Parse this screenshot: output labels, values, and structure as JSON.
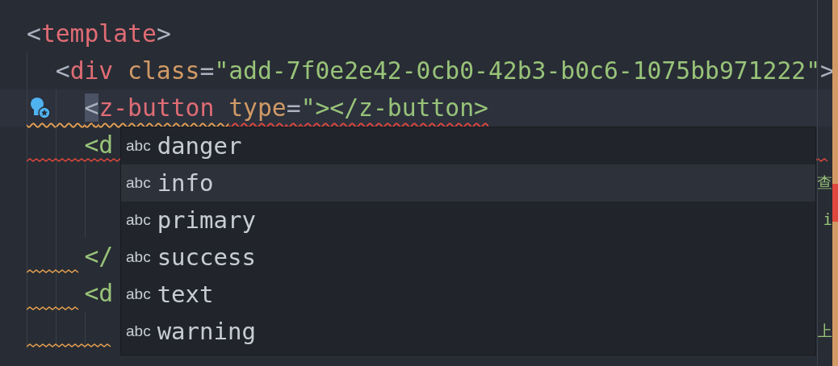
{
  "editor": {
    "lines": [
      {
        "current": false,
        "tokens": [
          {
            "text": "<",
            "kind": "punct"
          },
          {
            "text": "template",
            "kind": "tag"
          },
          {
            "text": ">",
            "kind": "punct"
          }
        ]
      },
      {
        "current": false,
        "tokens": [
          {
            "text": "  <",
            "kind": "punct"
          },
          {
            "text": "div",
            "kind": "tag"
          },
          {
            "text": " class",
            "kind": "attr"
          },
          {
            "text": "=",
            "kind": "punct"
          },
          {
            "text": "\"add-7f0e2e42-0cb0-42b3-b0c6-1075bb971222\"",
            "kind": "str"
          },
          {
            "text": ">",
            "kind": "punct"
          }
        ]
      },
      {
        "current": true,
        "tokens": [
          {
            "text": "    <",
            "kind": "punct",
            "warning_underline": true,
            "error_underline": false
          },
          {
            "text": "z-button ",
            "kind": "tag",
            "warning_underline": true,
            "error_underline": false
          },
          {
            "text": "type",
            "kind": "attr",
            "warning_underline": false,
            "error_underline": true
          },
          {
            "text": "=",
            "kind": "punct",
            "warning_underline": false,
            "error_underline": true
          },
          {
            "text": "\"></z-button>",
            "kind": "str",
            "warning_underline": false,
            "error_underline": true
          }
        ]
      },
      {
        "current": false,
        "line_error_underline": true,
        "tokens": [
          {
            "text": "    <d",
            "kind": "str"
          }
        ]
      },
      {
        "current": false,
        "right": [
          {
            "text": "查",
            "kind": "str"
          }
        ]
      },
      {
        "current": false,
        "right": [
          {
            "text": "i",
            "kind": "str"
          }
        ]
      },
      {
        "current": false,
        "indent_warning_underline": true,
        "tokens": [
          {
            "text": "    </",
            "kind": "str"
          }
        ]
      },
      {
        "current": false,
        "indent_warning_underline": true,
        "tokens": [
          {
            "text": "    <d",
            "kind": "str"
          }
        ]
      },
      {
        "current": false,
        "indent_warning_underline": true,
        "right": [
          {
            "text": "上",
            "kind": "str"
          }
        ]
      }
    ]
  },
  "suggestions": [
    {
      "kind_label": "abc",
      "label": "danger",
      "selected": false
    },
    {
      "kind_label": "abc",
      "label": "info",
      "selected": true
    },
    {
      "kind_label": "abc",
      "label": "primary",
      "selected": false
    },
    {
      "kind_label": "abc",
      "label": "success",
      "selected": false
    },
    {
      "kind_label": "abc",
      "label": "text",
      "selected": false
    },
    {
      "kind_label": "abc",
      "label": "warning",
      "selected": false
    }
  ]
}
